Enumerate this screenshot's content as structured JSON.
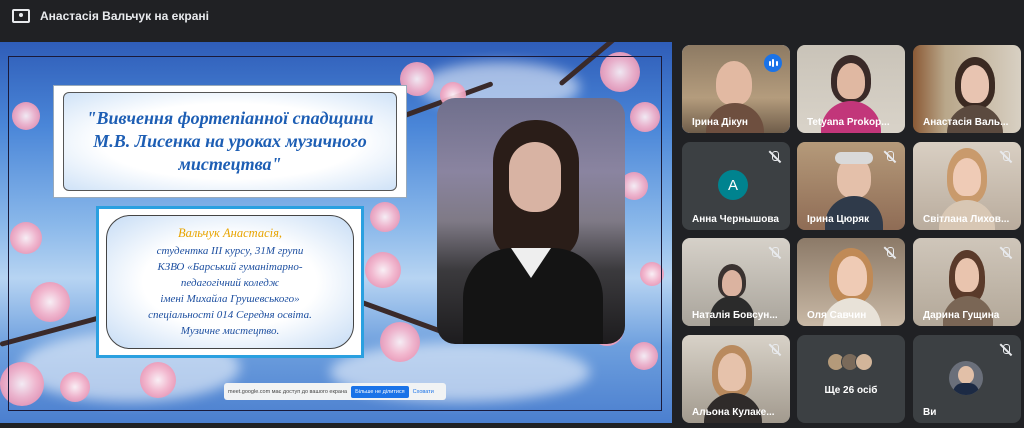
{
  "header": {
    "title": "Анастасія Вальчук на екрані"
  },
  "slide": {
    "title": "\"Вивчення фортепіанної спадщини М.В. Лисенка на уроках музичного мистецтва\"",
    "author": "Вальчук Анастасія,",
    "info_lines": [
      "студентка ІІІ курсу, 31М групи",
      "КЗВО «Барський гуманітарно-",
      "педагогічний коледж",
      "імені Михайла Грушевського»",
      "спеціальності 014 Середня освіта.",
      "Музичне мистецтво."
    ]
  },
  "share_toast": {
    "message": "meet.google.com має доступ до вашого екрана",
    "stop_label": "Більше не ділитися",
    "hide_label": "Сховати"
  },
  "participants": [
    {
      "name": "Ірина Дікун",
      "speaking": true
    },
    {
      "name": "Tetyana Prokop...",
      "muted": false
    },
    {
      "name": "Анастасія Валь...",
      "muted": false
    },
    {
      "name": "Анна Чернышова",
      "muted": true,
      "avatar_letter": "A"
    },
    {
      "name": "Ірина Цюряк",
      "muted": true
    },
    {
      "name": "Світлана Лихов...",
      "muted": true
    },
    {
      "name": "Наталія Бовсун...",
      "muted": true
    },
    {
      "name": "Оля Савчин",
      "muted": true
    },
    {
      "name": "Дарина Гущина",
      "muted": true
    },
    {
      "name": "Альона Кулаке...",
      "muted": true
    },
    {
      "name": "Ще 26 осіб"
    },
    {
      "name": "Ви",
      "muted": true
    }
  ],
  "colors": {
    "accent": "#1a73e8",
    "tile_bg": "#3c4043",
    "bg": "#202124",
    "active_border": "#8ab4f8"
  }
}
